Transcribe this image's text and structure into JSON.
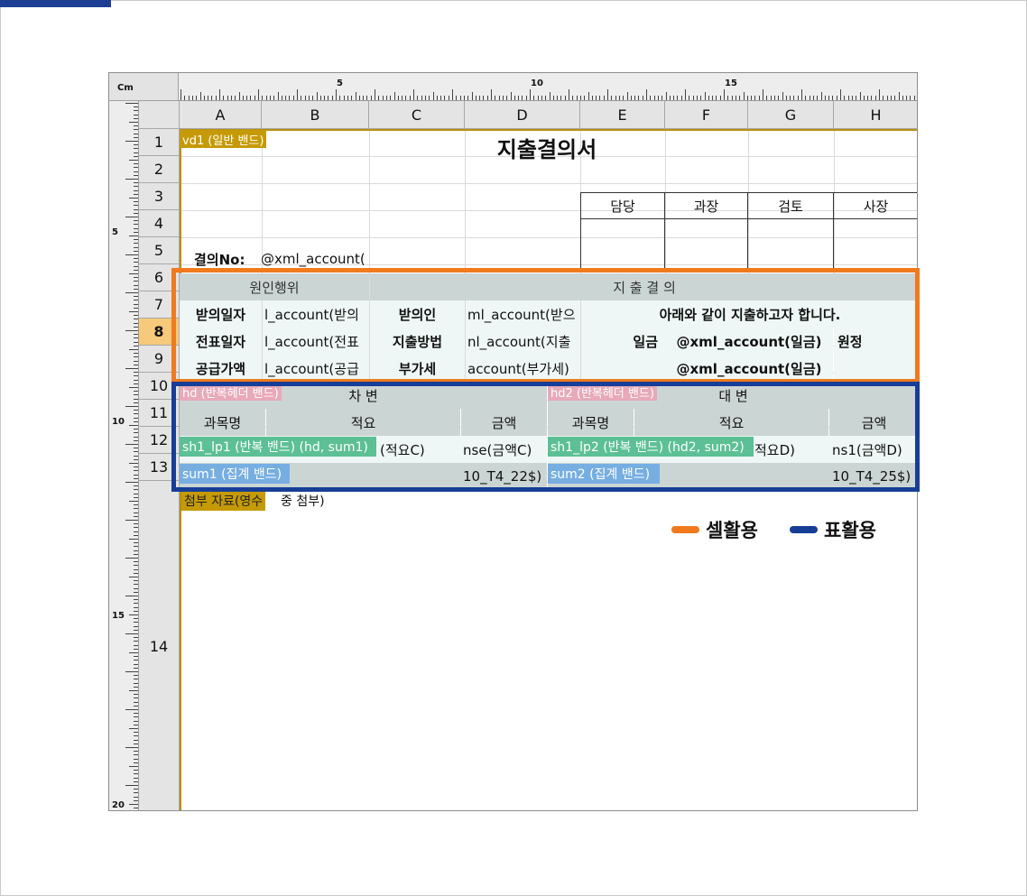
{
  "ruler": {
    "unit": "Cm",
    "h_numbers": [
      "5",
      "10",
      "15"
    ],
    "v_numbers": [
      "5",
      "10",
      "15",
      "20"
    ]
  },
  "columns": [
    "A",
    "B",
    "C",
    "D",
    "E",
    "F",
    "G",
    "H"
  ],
  "rows": [
    "1",
    "2",
    "3",
    "4",
    "5",
    "6",
    "7",
    "8",
    "9",
    "10",
    "11",
    "12",
    "13",
    "14"
  ],
  "selected_row": "8",
  "bands": {
    "vd1": "vd1 (일반 밴드)",
    "hd": "hd (반복헤더 밴드)",
    "hd2": "hd2 (반복헤더 밴드)",
    "sh1_lp1": "sh1_lp1 (반복 밴드) (hd, sum1)",
    "sh1_lp2": "sh1_lp2 (반복 밴드) (hd2, sum2)",
    "sum1": "sum1 (집계 밴드)",
    "sum2": "sum2 (집계 밴드)",
    "attach": "첨부 자료(영수"
  },
  "form": {
    "title": "지출결의서",
    "approval": [
      "담당",
      "과장",
      "검토",
      "사장"
    ],
    "resolution_no_label": "결의No:",
    "resolution_no_value": "@xml_account(",
    "r6_left": "원인행위",
    "r6_right": "지 출 결 의",
    "r7": {
      "a": "받의일자",
      "b": "l_account(받의",
      "c": "받의인",
      "d": "ml_account(받으",
      "efgh": "아래와 같이 지출하고자 합니다."
    },
    "r8": {
      "a": "전표일자",
      "b": "l_account(전표",
      "c": "지출방법",
      "d": "nl_account(지출",
      "e": "일금",
      "fg": "@xml_account(일금)",
      "h": "원정"
    },
    "r9": {
      "a": "공급가액",
      "b": "l_account(공급",
      "c": "부가세",
      "d": "account(부가세)",
      "fg": "@xml_account(일금)"
    },
    "r10": {
      "left": "차 변",
      "right": "대 변"
    },
    "r11": {
      "c1": "과목명",
      "c2": "적요",
      "c3": "금액",
      "c4": "과목명",
      "c5": "적요",
      "c6": "금액"
    },
    "r12": {
      "c2": "(적요C)",
      "c3": "nse(금액C)",
      "c5": "적요D)",
      "c6": "ns1(금액D)"
    },
    "r13": {
      "c3": "10_T4_22$)",
      "c6": "10_T4_25$)"
    },
    "r14": "중 첨부)"
  },
  "legend": [
    {
      "label": "셀활용",
      "color": "#f07a1d"
    },
    {
      "label": "표활용",
      "color": "#163e96"
    }
  ]
}
